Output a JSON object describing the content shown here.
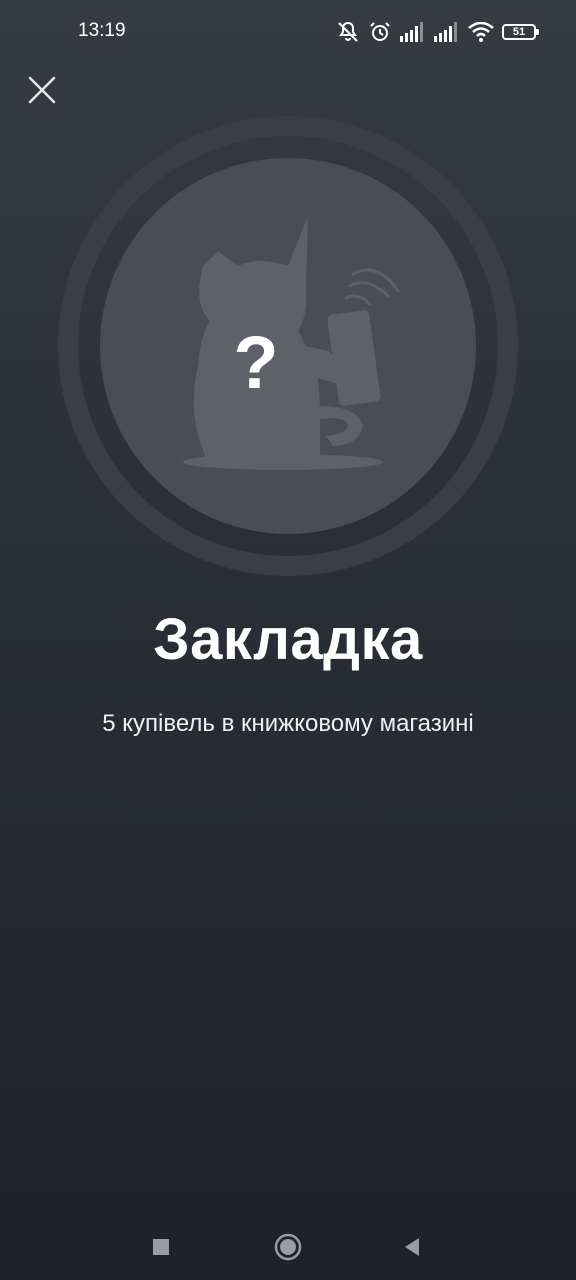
{
  "status_bar": {
    "time": "13:19",
    "battery_level": "51",
    "icons": [
      "mute-icon",
      "alarm-icon",
      "signal-icon",
      "signal-icon",
      "wifi-icon",
      "battery-icon"
    ]
  },
  "header": {
    "close_icon": "close-icon"
  },
  "achievement": {
    "badge_icon": "locked-cat-badge-icon",
    "badge_mark": "?",
    "title": "Закладка",
    "description": "5 купівель в книжковому магазині"
  },
  "nav_bar": {
    "buttons": [
      "recent-apps-icon",
      "home-icon",
      "back-icon"
    ]
  },
  "colors": {
    "background_top": "#363a42",
    "background_bottom": "#1f2128",
    "badge_ring": "#3b3e46",
    "badge_inner": "#4a4d55",
    "silhouette": "#5e6168",
    "text": "#ffffff"
  }
}
